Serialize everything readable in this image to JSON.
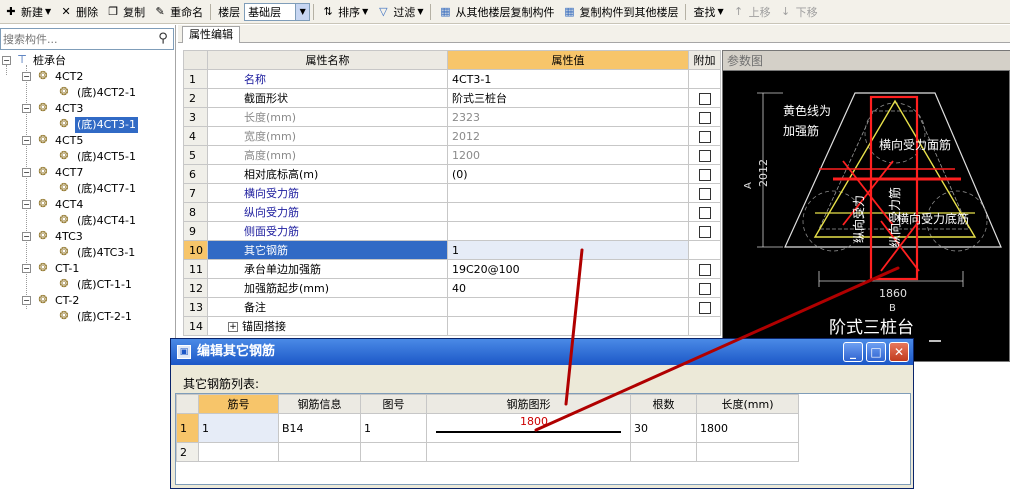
{
  "toolbar": {
    "new": "新建",
    "delete": "删除",
    "copy": "复制",
    "rename": "重命名",
    "floor_label": "楼层",
    "floor_value": "基础层",
    "sort": "排序",
    "filter": "过滤",
    "copy_from": "从其他楼层复制构件",
    "copy_to": "复制构件到其他楼层",
    "find": "查找",
    "move_up": "上移",
    "move_down": "下移"
  },
  "search": {
    "placeholder": "搜索构件..."
  },
  "tree": {
    "root": "桩承台",
    "groups": [
      {
        "name": "4CT2",
        "child": "(底)4CT2-1"
      },
      {
        "name": "4CT3",
        "child": "(底)4CT3-1"
      },
      {
        "name": "4CT5",
        "child": "(底)4CT5-1"
      },
      {
        "name": "4CT7",
        "child": "(底)4CT7-1"
      },
      {
        "name": "4CT4",
        "child": "(底)4CT4-1"
      },
      {
        "name": "4TC3",
        "child": "(底)4TC3-1"
      },
      {
        "name": "CT-1",
        "child": "(底)CT-1-1"
      },
      {
        "name": "CT-2",
        "child": "(底)CT-2-1"
      }
    ]
  },
  "props": {
    "tab": "属性编辑",
    "col_name": "属性名称",
    "col_value": "属性值",
    "col_extra": "附加",
    "rows": [
      {
        "no": "1",
        "name": "名称",
        "value": "4CT3-1"
      },
      {
        "no": "2",
        "name": "截面形状",
        "value": "阶式三桩台"
      },
      {
        "no": "3",
        "name": "长度(mm)",
        "value": "2323"
      },
      {
        "no": "4",
        "name": "宽度(mm)",
        "value": "2012"
      },
      {
        "no": "5",
        "name": "高度(mm)",
        "value": "1200"
      },
      {
        "no": "6",
        "name": "相对底标高(m)",
        "value": "(0)"
      },
      {
        "no": "7",
        "name": "横向受力筋",
        "value": ""
      },
      {
        "no": "8",
        "name": "纵向受力筋",
        "value": ""
      },
      {
        "no": "9",
        "name": "侧面受力筋",
        "value": ""
      },
      {
        "no": "10",
        "name": "其它钢筋",
        "value": "1"
      },
      {
        "no": "11",
        "name": "承台单边加强筋",
        "value": "19C20@100"
      },
      {
        "no": "12",
        "name": "加强筋起步(mm)",
        "value": "40"
      },
      {
        "no": "13",
        "name": "备注",
        "value": ""
      },
      {
        "no": "14",
        "name": "锚固搭接",
        "value": ""
      }
    ]
  },
  "diagram": {
    "title": "参数图",
    "note_line1": "黄色线为",
    "note_line2": "加强筋",
    "label_top": "横向受力面筋",
    "label_bottom": "横向受力底筋",
    "label_side1": "纵向受力",
    "label_side2": "纵向受力筋",
    "dim_a": "2012",
    "dim_a_letter": "A",
    "dim_b": "1860",
    "dim_b_letter": "B",
    "caption": "阶式三桩台"
  },
  "dialog": {
    "title": "编辑其它钢筋",
    "list_label": "其它钢筋列表:",
    "columns": [
      "筋号",
      "钢筋信息",
      "图号",
      "钢筋图形",
      "根数",
      "长度(mm)"
    ],
    "rows": [
      {
        "no": "1",
        "bar_no": "1",
        "info": "B14",
        "fig": "1",
        "shape": "1800",
        "count": "30",
        "length": "1800"
      },
      {
        "no": "2",
        "bar_no": "",
        "info": "",
        "fig": "",
        "shape": "",
        "count": "",
        "length": ""
      }
    ]
  },
  "colors": {
    "highlight": "#f7c56a",
    "selection": "#316ac5",
    "annotation": "#b00000",
    "rebar_yellow": "#e8e14a",
    "rebar_red": "#ff2020"
  }
}
